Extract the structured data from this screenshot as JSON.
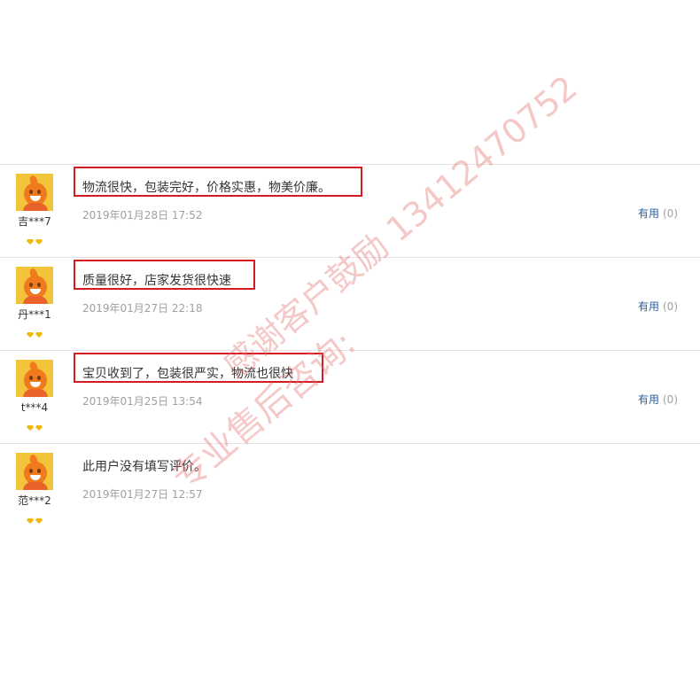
{
  "reviews": [
    {
      "user": "吉***7",
      "comment": "物流很快，包装完好，价格实惠，物美价廉。",
      "date": "2019年01月28日 17:52",
      "useful_label": "有用",
      "useful_count": "(0)",
      "highlighted": true
    },
    {
      "user": "丹***1",
      "comment": "质量很好，店家发货很快速",
      "date": "2019年01月27日 22:18",
      "useful_label": "有用",
      "useful_count": "(0)",
      "highlighted": true
    },
    {
      "user": "t***4",
      "comment": "宝贝收到了，包装很严实，物流也很快",
      "date": "2019年01月25日 13:54",
      "useful_label": "有用",
      "useful_count": "(0)",
      "highlighted": true
    },
    {
      "user": "范***2",
      "comment": "此用户没有填写评价。",
      "date": "2019年01月27日 12:57",
      "useful_label": "",
      "useful_count": "",
      "highlighted": false
    }
  ],
  "watermark": {
    "line1": "感谢客户鼓励 13412470752",
    "line2": "专业售后咨询:"
  }
}
